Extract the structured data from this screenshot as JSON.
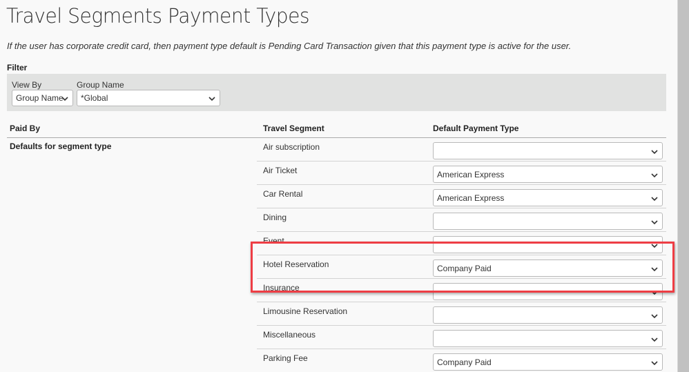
{
  "page": {
    "title": "Travel Segments Payment Types",
    "subtitle": "If the user has corporate credit card, then payment type default is Pending Card Transaction given that this payment type is active for the user."
  },
  "filter": {
    "label": "Filter",
    "view_by": {
      "label": "View By",
      "value": "Group Name"
    },
    "group_name": {
      "label": "Group Name",
      "value": "*Global"
    }
  },
  "table": {
    "columns": [
      "Paid By",
      "Travel Segment",
      "Default Payment Type"
    ],
    "paid_by_value": "Defaults for segment type",
    "rows": [
      {
        "segment": "Air subscription",
        "payment_type": ""
      },
      {
        "segment": "Air Ticket",
        "payment_type": "American Express"
      },
      {
        "segment": "Car Rental",
        "payment_type": "American Express"
      },
      {
        "segment": "Dining",
        "payment_type": ""
      },
      {
        "segment": "Event",
        "payment_type": ""
      },
      {
        "segment": "Hotel Reservation",
        "payment_type": "Company Paid"
      },
      {
        "segment": "Insurance",
        "payment_type": ""
      },
      {
        "segment": "Limousine Reservation",
        "payment_type": ""
      },
      {
        "segment": "Miscellaneous",
        "payment_type": ""
      },
      {
        "segment": "Parking Fee",
        "payment_type": "Company Paid"
      }
    ]
  },
  "annotation": {
    "highlighted_row": "Hotel Reservation",
    "color": "#ee3d44"
  },
  "icons": {
    "dropdown": "chevron-down-icon"
  }
}
